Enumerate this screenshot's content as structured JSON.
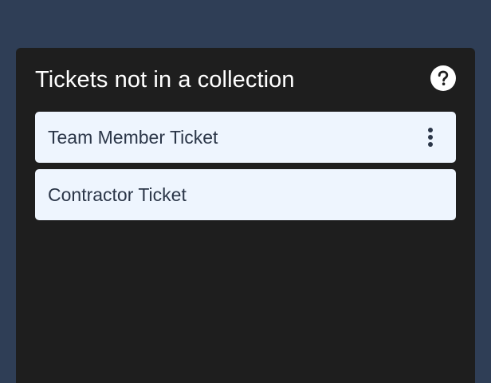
{
  "panel": {
    "title": "Tickets not in a collection",
    "help_icon": "question-mark-circle-icon",
    "tickets": [
      {
        "label": "Team Member Ticket",
        "has_menu": true,
        "menu_icon": "more-vertical-icon"
      },
      {
        "label": "Contractor Ticket",
        "has_menu": false
      }
    ]
  },
  "colors": {
    "page_background": "#2f3e56",
    "panel_background": "#1e1e1e",
    "ticket_background": "#eef5fe",
    "ticket_text": "#2b3648",
    "title_text": "#ffffff"
  }
}
